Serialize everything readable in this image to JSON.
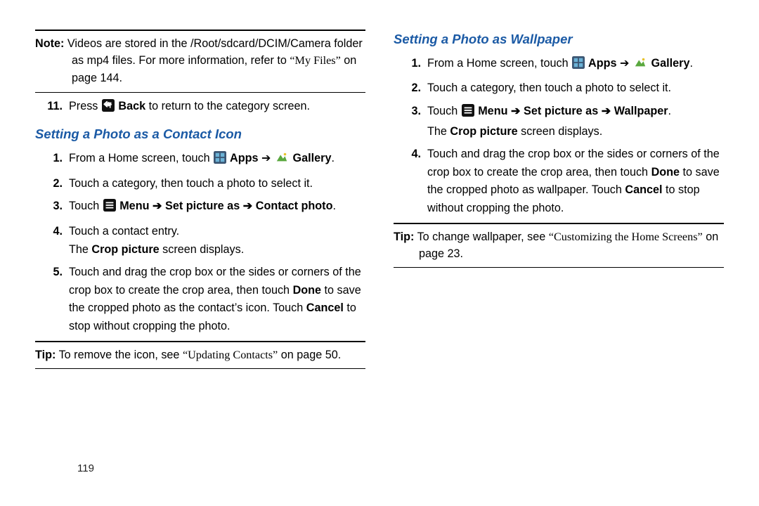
{
  "left": {
    "note_label": "Note:",
    "note_body": " Videos are stored in the /Root/sdcard/DCIM/Camera folder as mp4 files. For more information, refer to ",
    "note_quote": "“My Files”",
    "note_tail": " on page 144.",
    "step11_num": "11.",
    "step11_a": "Press ",
    "step11_back": " Back",
    "step11_b": " to return to the category screen.",
    "heading": "Setting a Photo as a Contact Icon",
    "s1_num": "1.",
    "s1_a": "From a Home screen, touch ",
    "s1_apps": " Apps",
    "s1_arrow": " ➔ ",
    "s1_gallery": " Gallery",
    "s1_dot": ".",
    "s2_num": "2.",
    "s2": "Touch a category, then touch a photo to select it.",
    "s3_num": "3.",
    "s3_a": "Touch ",
    "s3_menu": " Menu",
    "s3_arrow1": " ➔ ",
    "s3_set": "Set picture as",
    "s3_arrow2": " ➔ ",
    "s3_contact": "Contact photo",
    "s3_dot": ".",
    "s4_num": "4.",
    "s4_a": "Touch a contact entry.",
    "s4_b1": "The ",
    "s4_b2": "Crop picture",
    "s4_b3": " screen displays.",
    "s5_num": "5.",
    "s5_a": "Touch and drag the crop box or the sides or corners of the crop box to create the crop area, then touch ",
    "s5_done": "Done",
    "s5_b": " to save the cropped photo as the contact’s icon. Touch ",
    "s5_cancel": "Cancel",
    "s5_c": " to stop without cropping the photo.",
    "tip_label": "Tip:",
    "tip_a": " To remove the icon, see ",
    "tip_quote": "“Updating Contacts”",
    "tip_b": " on page 50."
  },
  "right": {
    "heading": "Setting a Photo as Wallpaper",
    "s1_num": "1.",
    "s1_a": "From a Home screen, touch ",
    "s1_apps": " Apps",
    "s1_arrow": " ➔ ",
    "s1_gallery": " Gallery",
    "s1_dot": ".",
    "s2_num": "2.",
    "s2": "Touch a category, then touch a photo to select it.",
    "s3_num": "3.",
    "s3_a": "Touch ",
    "s3_menu": " Menu",
    "s3_arrow1": " ➔ ",
    "s3_set": "Set picture as",
    "s3_arrow2": " ➔ ",
    "s3_wall": "Wallpaper",
    "s3_dot": ".",
    "s3_b1": "The ",
    "s3_b2": "Crop picture",
    "s3_b3": " screen displays.",
    "s4_num": "4.",
    "s4_a": "Touch and drag the crop box or the sides or corners of the crop box to create the crop area, then touch ",
    "s4_done": "Done",
    "s4_b": " to save the cropped photo as wallpaper. Touch ",
    "s4_cancel": "Cancel",
    "s4_c": " to stop without cropping the photo.",
    "tip_label": "Tip:",
    "tip_a": " To change wallpaper, see ",
    "tip_quote": "“Customizing the Home Screens”",
    "tip_b": " on page 23."
  },
  "page_number": "119"
}
